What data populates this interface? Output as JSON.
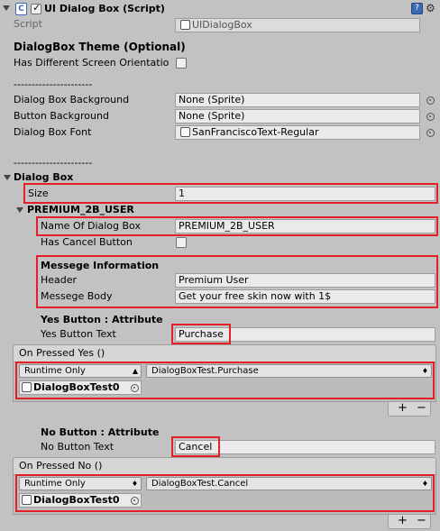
{
  "header": {
    "title": "UI Dialog Box (Script)",
    "script_label": "Script",
    "script_value": "UIDialogBox"
  },
  "theme": {
    "heading": "DialogBox Theme (Optional)",
    "orientation_label": "Has Different Screen Orientatio"
  },
  "separator1": "----------------------",
  "sprites": {
    "bg_label": "Dialog Box Background",
    "bg_value": "None (Sprite)",
    "btn_label": "Button Background",
    "btn_value": "None (Sprite)",
    "font_label": "Dialog Box Font",
    "font_value": "SanFranciscoText-Regular"
  },
  "separator2": "----------------------",
  "dialog": {
    "heading": "Dialog Box",
    "size_label": "Size",
    "size_value": "1",
    "element_title": "PREMIUM_2B_USER",
    "name_label": "Name Of Dialog Box",
    "name_value": "PREMIUM_2B_USER",
    "cancel_label": "Has Cancel Button",
    "message_heading": "Messege Information",
    "header_label": "Header",
    "header_value": "Premium User",
    "body_label": "Messege Body",
    "body_value": "Get your free skin now with 1$",
    "yes_heading": "Yes Button : Attribute",
    "yes_text_label": "Yes Button Text",
    "yes_text_value": "Purchase",
    "yes_event_title": "On Pressed Yes ()",
    "yes_runtime": "Runtime Only",
    "yes_function": "DialogBoxTest.Purchase",
    "yes_object": "DialogBoxTest0",
    "no_heading": "No Button : Attribute",
    "no_text_label": "No Button Text",
    "no_text_value": "Cancel",
    "no_event_title": "On Pressed No ()",
    "no_runtime": "Runtime Only",
    "no_function": "DialogBoxTest.Cancel",
    "no_object": "DialogBoxTest0",
    "plus": "+",
    "minus": "−"
  },
  "colors": {
    "highlight": "#e3202a",
    "panel": "#c2c2c2"
  }
}
